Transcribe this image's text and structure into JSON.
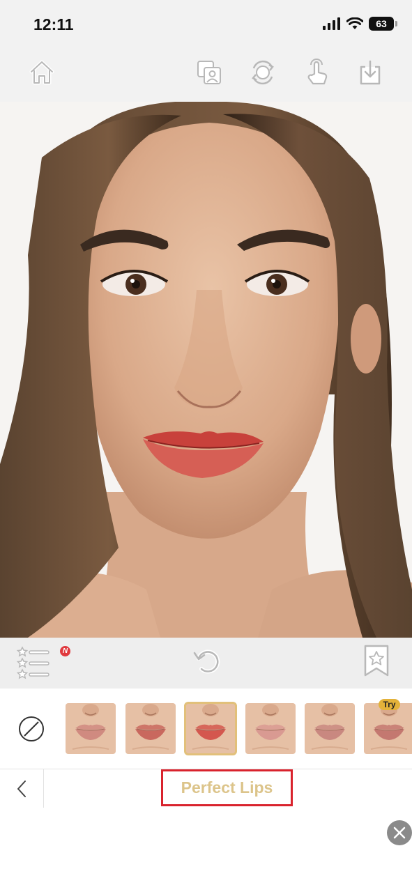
{
  "status_bar": {
    "time": "12:11",
    "battery": "63"
  },
  "top_toolbar": {
    "home_icon": "home-icon",
    "compare_icon": "photo-compare-icon",
    "face_icon": "face-switch-icon",
    "touch_icon": "touch-icon",
    "download_icon": "download-icon"
  },
  "tools_row": {
    "badge": "N"
  },
  "swatches": {
    "items": [
      {
        "lip_color": "#d08a80"
      },
      {
        "lip_color": "#c9685e"
      },
      {
        "lip_color": "#d4574e",
        "selected": true
      },
      {
        "lip_color": "#d99a92"
      },
      {
        "lip_color": "#c98880"
      },
      {
        "lip_color": "#c47870",
        "try": "Try"
      }
    ],
    "try_label": "Try"
  },
  "category": {
    "title": "Perfect Lips"
  },
  "colors": {
    "accent_gold": "#dcc48a",
    "highlight_red": "#d9232d",
    "badge_red": "#e0393e"
  }
}
